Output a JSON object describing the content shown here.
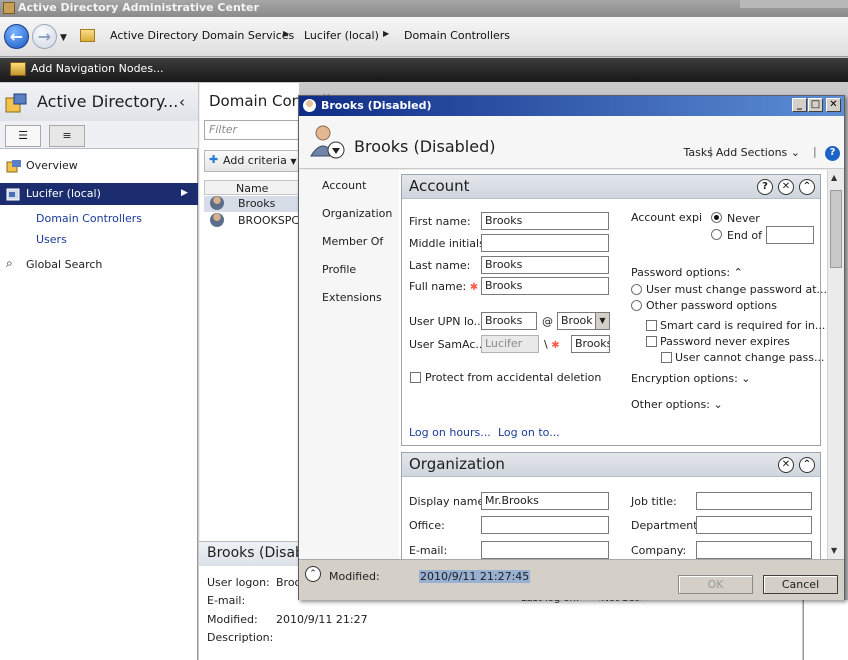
{
  "app": {
    "title": "Active Directory Administrative Center"
  },
  "breadcrumbs": [
    "Active Directory Domain Services",
    "Lucifer (local)",
    "Domain Controllers"
  ],
  "nav_nodes_label": "Add Navigation Nodes...",
  "left_pane": {
    "title": "Active Directory...",
    "items": [
      {
        "label": "Overview"
      },
      {
        "label": "Lucifer (local)"
      },
      {
        "label": "Domain Controllers"
      },
      {
        "label": "Users"
      },
      {
        "label": "Global Search"
      }
    ]
  },
  "center_pane": {
    "title": "Domain Controllers",
    "filter_placeholder": "Filter",
    "add_criteria": "Add criteria",
    "column_name": "Name",
    "rows": [
      "Brooks",
      "BROOKSPCNAME"
    ]
  },
  "details": {
    "title": "Brooks (Disabled)",
    "user_logon_label": "User logon:",
    "user_logon_value": "Brooks",
    "email_label": "E-mail:",
    "modified_label": "Modified:",
    "modified_value": "2010/9/11 21:27",
    "description_label": "Description:",
    "last_logon_label": "Last log on:",
    "last_logon_value": "<Not Set>"
  },
  "dialog": {
    "title": "Brooks (Disabled)",
    "header_title": "Brooks (Disabled)",
    "tasks": "Tasks",
    "add_sections": "Add Sections",
    "help": "?",
    "side_nav": [
      "Account",
      "Organization",
      "Member Of",
      "Profile",
      "Extensions"
    ],
    "account": {
      "title": "Account",
      "first_name_label": "First name:",
      "first_name": "Brooks",
      "middle_initials_label": "Middle initials:",
      "middle_initials": "",
      "last_name_label": "Last name:",
      "last_name": "Brooks",
      "full_name_label": "Full name:",
      "full_name": "Brooks",
      "upn_label": "User UPN lo...",
      "upn_value": "Brooks",
      "upn_at": "@",
      "upn_domain": "Brook",
      "sam_label": "User SamAc...",
      "sam_domain": "Lucifer",
      "sam_sep": "\\",
      "sam_value": "Brooks",
      "protect_label": "Protect from accidental deletion",
      "expires_label": "Account expi",
      "never_label": "Never",
      "end_of_label": "End of",
      "pw_options_label": "Password options:",
      "must_change_label": "User must change password at...",
      "other_pw_label": "Other password options",
      "smart_card_label": "Smart card is required for in...",
      "never_expires_label": "Password never expires",
      "cannot_change_label": "User cannot change pass...",
      "encryption_label": "Encryption options:",
      "other_options_label": "Other options:",
      "log_on_hours": "Log on hours...",
      "log_on_to": "Log on to..."
    },
    "organization": {
      "title": "Organization",
      "display_name_label": "Display name:",
      "display_name": "Mr.Brooks",
      "office_label": "Office:",
      "email_label": "E-mail:",
      "job_title_label": "Job title:",
      "department_label": "Department:",
      "company_label": "Company:"
    },
    "footer": {
      "modified_label": "Modified:",
      "modified_value": "2010/9/11 21:27:45",
      "ok": "OK",
      "cancel": "Cancel"
    }
  },
  "colors": {
    "title_gradient_start": "#0f2c86",
    "selection": "#1b2d6f",
    "link": "#1c3b97",
    "required": "#ff5a4c"
  }
}
